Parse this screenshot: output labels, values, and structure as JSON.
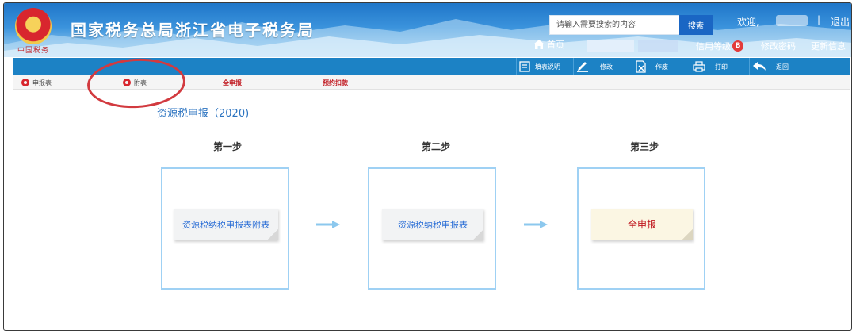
{
  "header": {
    "site_title": "国家税务总局浙江省电子税务局",
    "emblem_caption": "中国税务",
    "search_placeholder": "请输入需要搜索的内容",
    "search_button": "搜索",
    "welcome": "欢迎,",
    "logout": "退出",
    "home": "首页",
    "credit_label": "信用等级",
    "credit_level": "B",
    "change_password": "修改密码",
    "update_info": "更新信息"
  },
  "toolbar": {
    "fill_instructions": "填表说明",
    "edit": "修改",
    "void": "作废",
    "print": "打印",
    "back": "返回"
  },
  "tabs": {
    "declaration_form": "申报表",
    "attachment": "附表",
    "full_declaration": "全申报",
    "scheduled_deduction": "预约扣款"
  },
  "main": {
    "title": "资源税申报（2020)",
    "steps": [
      {
        "label": "第一步",
        "action": "资源税纳税申报表附表"
      },
      {
        "label": "第二步",
        "action": "资源税纳税申报表"
      },
      {
        "label": "第三步",
        "action": "全申报"
      }
    ]
  },
  "colors": {
    "accent_blue": "#1c82c5",
    "header_blue": "#1f76c9",
    "link_blue": "#2c6fd6",
    "alert_red": "#c0171e",
    "annotation_red": "#d23a3f"
  }
}
